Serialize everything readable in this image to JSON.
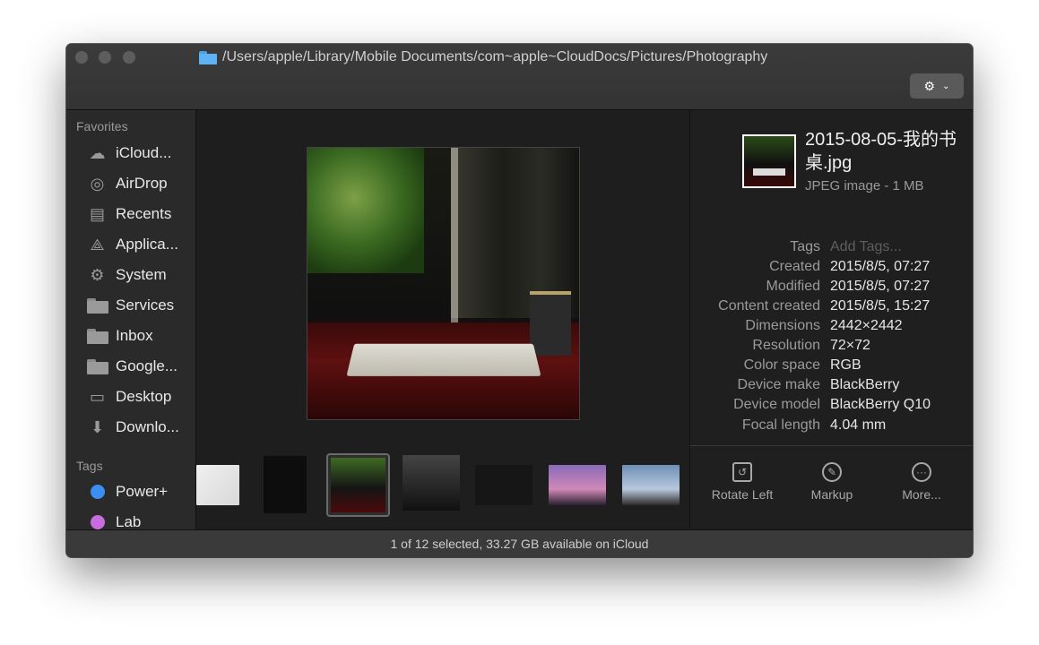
{
  "window": {
    "path": "/Users/apple/Library/Mobile Documents/com~apple~CloudDocs/Pictures/Photography",
    "path_icon": "folder-icon",
    "action_button_icon": "gear-icon"
  },
  "sidebar": {
    "favorites_title": "Favorites",
    "favorites": [
      {
        "label": "iCloud...",
        "icon": "cloud-icon"
      },
      {
        "label": "AirDrop",
        "icon": "airdrop-icon"
      },
      {
        "label": "Recents",
        "icon": "recents-icon"
      },
      {
        "label": "Applica...",
        "icon": "applications-icon"
      },
      {
        "label": "System",
        "icon": "gear-icon"
      },
      {
        "label": "Services",
        "icon": "folder-icon"
      },
      {
        "label": "Inbox",
        "icon": "folder-icon"
      },
      {
        "label": "Google...",
        "icon": "folder-icon"
      },
      {
        "label": "Desktop",
        "icon": "desktop-icon"
      },
      {
        "label": "Downlo...",
        "icon": "download-icon"
      }
    ],
    "tags_title": "Tags",
    "tags": [
      {
        "label": "Power+",
        "color": "#3b8ff2"
      },
      {
        "label": "Lab",
        "color": "#c86de0"
      }
    ]
  },
  "info": {
    "filename": "2015-08-05-我的书桌.jpg",
    "filetype": "JPEG image - 1 MB",
    "rows": [
      {
        "label": "Tags",
        "value": "Add Tags..."
      },
      {
        "label": "Created",
        "value": "2015/8/5, 07:27"
      },
      {
        "label": "Modified",
        "value": "2015/8/5, 07:27"
      },
      {
        "label": "Content created",
        "value": "2015/8/5, 15:27"
      },
      {
        "label": "Dimensions",
        "value": "2442×2442"
      },
      {
        "label": "Resolution",
        "value": "72×72"
      },
      {
        "label": "Color space",
        "value": "RGB"
      },
      {
        "label": "Device make",
        "value": "BlackBerry"
      },
      {
        "label": "Device model",
        "value": "BlackBerry Q10"
      },
      {
        "label": "Focal length",
        "value": "4.04 mm"
      }
    ]
  },
  "actions": [
    {
      "label": "Rotate Left",
      "icon": "rotate-left-icon"
    },
    {
      "label": "Markup",
      "icon": "markup-icon"
    },
    {
      "label": "More...",
      "icon": "more-icon"
    }
  ],
  "status": "1 of 12 selected, 33.27 GB available on iCloud"
}
